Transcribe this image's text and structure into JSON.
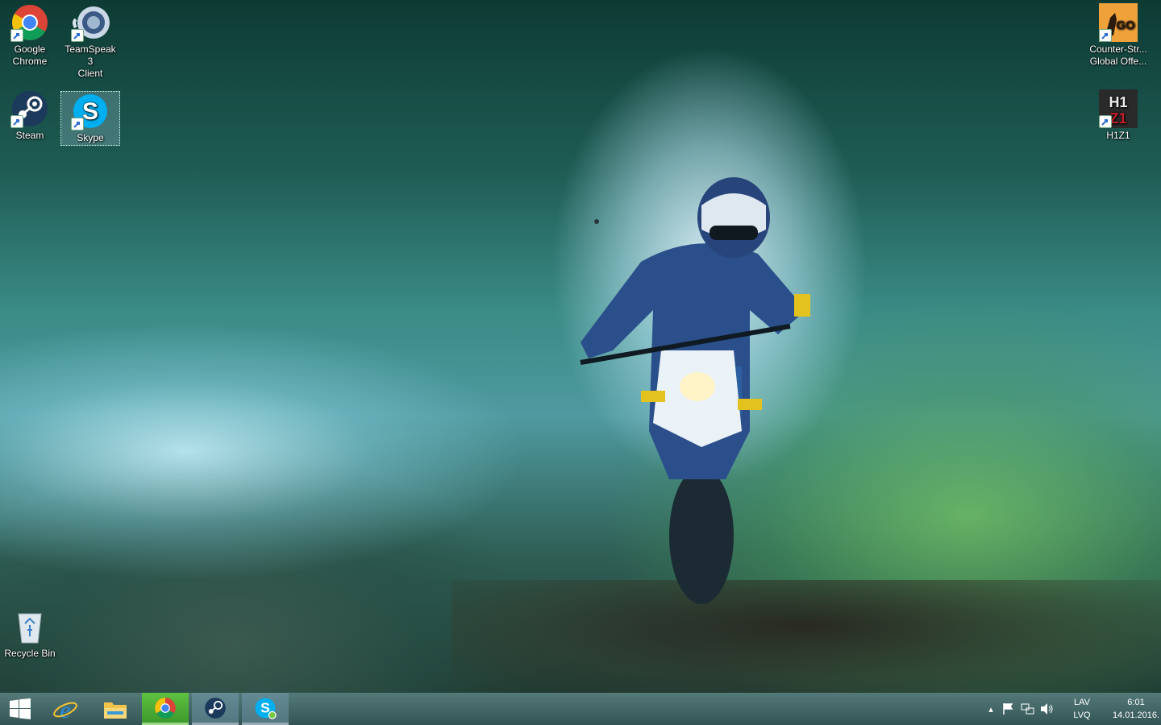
{
  "desktop": {
    "icons": [
      {
        "label": "Google\nChrome",
        "name": "google-chrome"
      },
      {
        "label": "TeamSpeak 3\nClient",
        "name": "teamspeak"
      },
      {
        "label": "Steam",
        "name": "steam"
      },
      {
        "label": "Skype",
        "name": "skype"
      },
      {
        "label": "Counter-Str...\nGlobal Offe...",
        "name": "csgo"
      },
      {
        "label": "H1Z1",
        "name": "h1z1"
      },
      {
        "label": "Recycle Bin",
        "name": "recycle-bin"
      }
    ],
    "icon_art": {
      "h1z1": "H1\nZ1",
      "csgo": "GO"
    }
  },
  "taskbar": {
    "apps": [
      "start",
      "internet-explorer",
      "file-explorer",
      "google-chrome",
      "steam",
      "skype"
    ],
    "tray": {
      "language_top": "LAV",
      "language_bottom": "LVQ",
      "time": "6:01",
      "date": "14.01.2016."
    }
  },
  "colors": {
    "chrome_green": "#4caf50",
    "skype_blue": "#00aff0",
    "taskbar": "#2f5a5a"
  }
}
